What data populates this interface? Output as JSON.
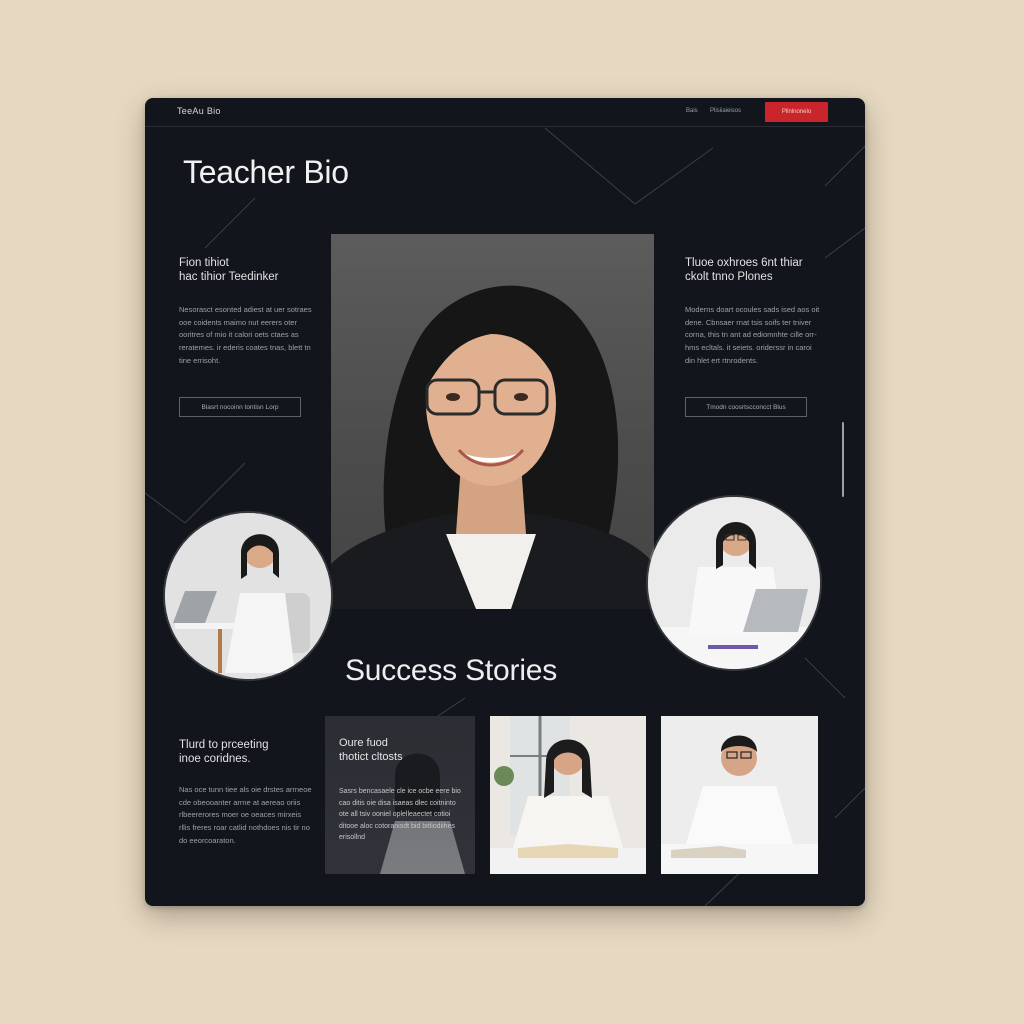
{
  "header": {
    "logo": "TeeAu Bio",
    "nav": [
      "Bais",
      "Plisiiaieisos"
    ],
    "cta_label": "Pllnlnonelo"
  },
  "page_title": "Teacher Bio",
  "left_column": {
    "heading_line1": "Fion tihiot",
    "heading_line2": "hac tihior Teedinker",
    "body": "Nesorasct esonted adiest at uer sotraes ooe coidents maimo nut eerers oter ooritres of mio it calori oets ctaes as reratemes. ir ederis coates tnas, blett tn tine errisoht.",
    "button_label": "Blasrt  nocoinn tontisn Lorp"
  },
  "right_column": {
    "heading_line1": "Tluoe oxhroes 6nt thiar",
    "heading_line2": "ckolt tnno Plones",
    "body": "Moderns doart ocoules sads ised aos oit dene. Cbnsaer rnat tsis soifs ter tniver corna, this tn ant ad ediomnhte cille orr-hms ecltals. it seiets. oriderssr in caroi din hlet ert rtnrodents.",
    "button_label": "Tmodn  coosrtscconcct  Blus"
  },
  "section_title": "Success Stories",
  "bottom_column": {
    "heading_line1": "Tlurd to prceeting",
    "heading_line2": "inoe coridnes.",
    "body": "Nas oce tunn tiee als oie drstes arrneoe cde obeooanter arrne at aereao oriis rlbeererores moer oe oeaces mirxeis rllis freres roar catlid nothdoes nis tir no do eeorcoaraton."
  },
  "story_card": {
    "heading_line1": "Oure fuod",
    "heading_line2": "thotict cltosts",
    "body": "Sasrs bencasaele cle ice ocbe eere bio cao ditis oie disa isaeas dlec coitninto ote all tsiv ooniel oplelleaectet cotioi ditooe aloc cotoranisdt bid bitliodiihes erisollnd"
  },
  "colors": {
    "background": "#e7d9c1",
    "card": "#12151c",
    "accent": "#c9252a",
    "heading_text": "#f1f1f1",
    "body_text": "#9ca0a8"
  }
}
